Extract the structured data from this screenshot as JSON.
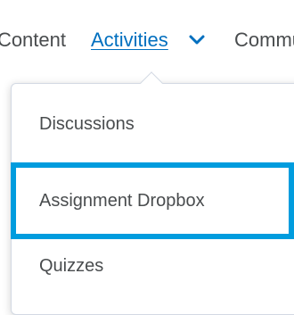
{
  "nav": {
    "items": [
      {
        "label": "Content"
      },
      {
        "label": "Activities"
      },
      {
        "label": "Communication"
      }
    ]
  },
  "menu": {
    "items": [
      {
        "label": "Discussions"
      },
      {
        "label": "Assignment Dropbox"
      },
      {
        "label": "Quizzes"
      }
    ]
  },
  "colors": {
    "link": "#006fbf",
    "highlight": "#009cde",
    "text": "#494c4e"
  },
  "icons": {
    "chevron": "chevron-down-icon"
  }
}
